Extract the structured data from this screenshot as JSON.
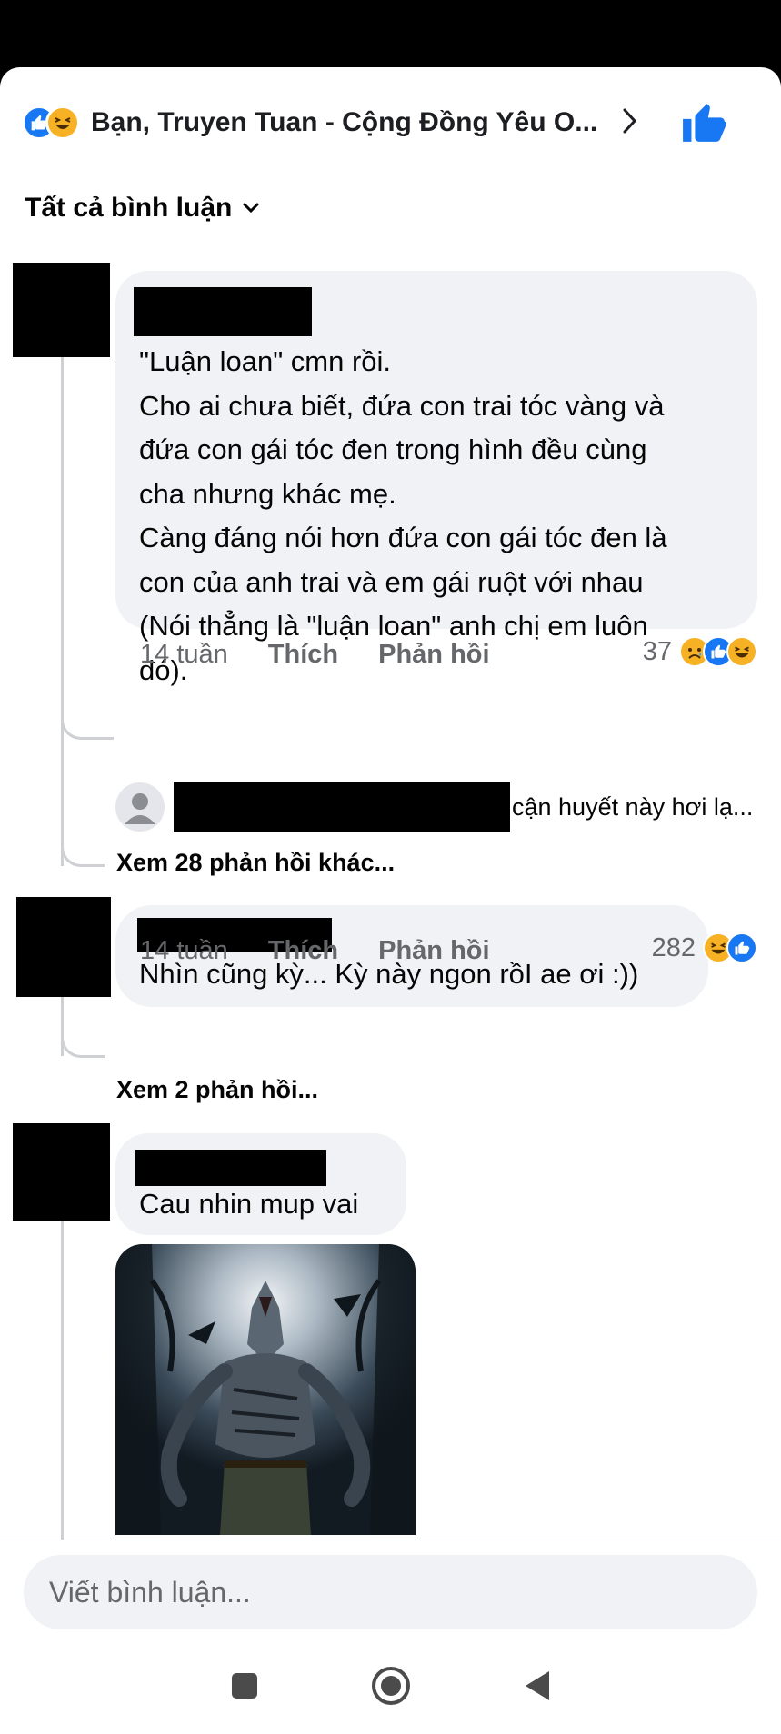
{
  "header": {
    "title": "Bạn, Truyen Tuan - Cộng Đồng Yêu O...",
    "reaction_icons": [
      "like-icon",
      "haha-icon"
    ]
  },
  "filter": {
    "label": "Tất cả bình luận"
  },
  "comments": [
    {
      "text_lines": [
        "\"Luận loan\" cmn rồi.",
        "Cho ai chưa biết, đứa con trai tóc vàng và",
        "đứa con gái tóc đen trong hình đều cùng",
        "cha nhưng khác mẹ.",
        "Càng đáng nói hơn đứa con gái tóc đen là",
        "con của anh trai và em gái ruột với nhau",
        "(Nói thẳng là \"luận loan\" anh chị em luôn",
        "đó)."
      ],
      "time": "14 tuần",
      "like_label": "Thích",
      "reply_label": "Phản hồi",
      "reaction_count": "37",
      "reactions": [
        "sad-icon",
        "like-icon",
        "haha-icon"
      ],
      "reply_preview": "cận huyết này hơi lạ...",
      "more_replies": "Xem 28 phản hồi khác..."
    },
    {
      "text": "Nhìn cũng kỳ... Kỳ này ngon rồI ae ơi :))",
      "time": "14 tuần",
      "like_label": "Thích",
      "reply_label": "Phản hồi",
      "reaction_count": "282",
      "reactions": [
        "haha-icon",
        "like-icon"
      ],
      "more_replies": "Xem 2 phản hồi..."
    },
    {
      "text": "Cau nhin mup vai",
      "image": "werewolf-illustration"
    }
  ],
  "composer": {
    "placeholder": "Viết bình luận..."
  },
  "colors": {
    "accent": "#1877f2",
    "bubble": "#f0f2f5",
    "meta": "#65676b",
    "haha": "#f7b125"
  }
}
